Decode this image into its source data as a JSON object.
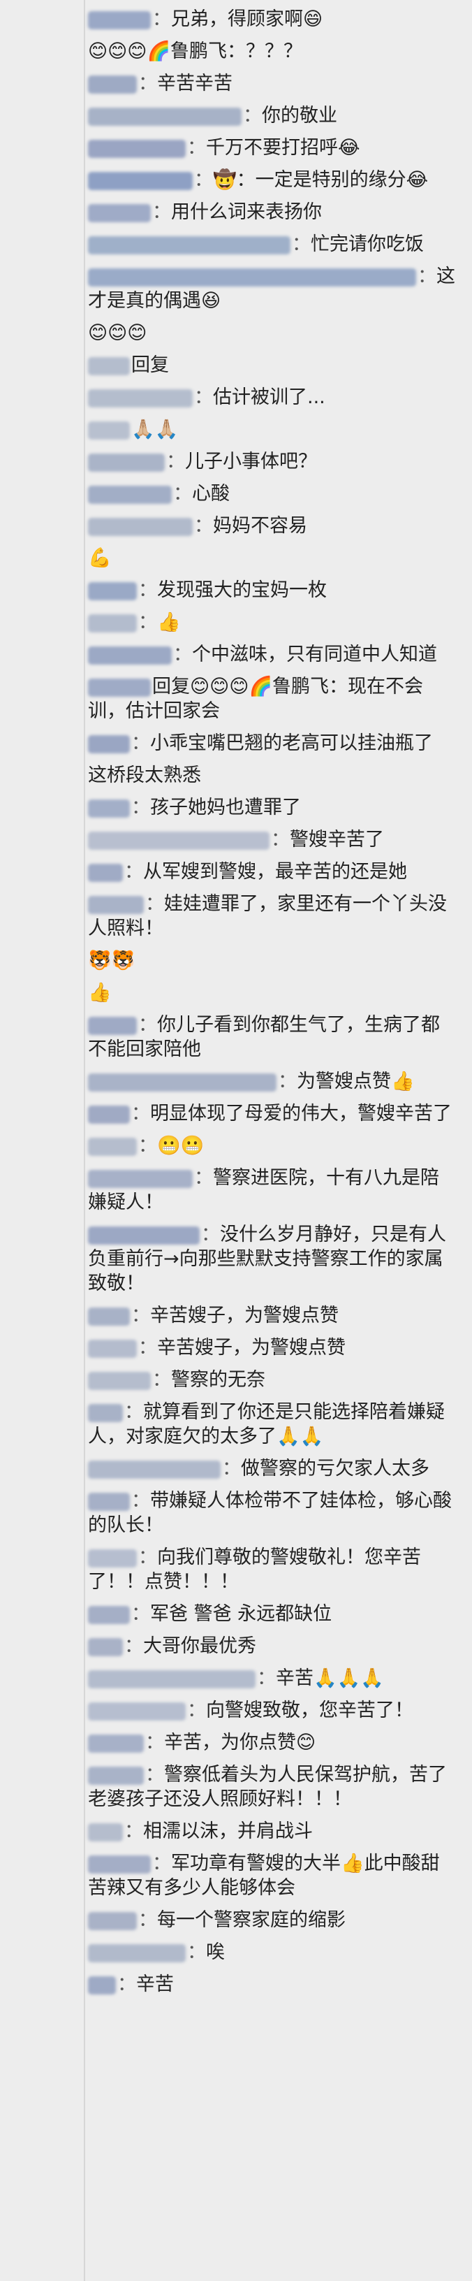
{
  "colors": {
    "background": "#ededed",
    "text": "#222222",
    "nick_link_blue": "#5c7fb8",
    "nick_blur_gray": "#b8b8b8"
  },
  "comments": [
    {
      "nick_w": 90,
      "nick_color": "#9aa8c6",
      "sep": "：",
      "text": "兄弟，得顾家啊😄"
    },
    {
      "nick_w": 0,
      "nick_color": "",
      "sep": "",
      "text": "😊😊😊🌈鲁鹏飞：？？？"
    },
    {
      "nick_w": 70,
      "nick_color": "#9eaac4",
      "sep": "：",
      "text": "辛苦辛苦"
    },
    {
      "nick_w": 220,
      "nick_color": "#a7b2c7",
      "sep": "：",
      "text": "你的敬业"
    },
    {
      "nick_w": 140,
      "nick_color": "#9aa5c3",
      "sep": "：",
      "text": "千万不要打招呼😂"
    },
    {
      "nick_w": 150,
      "nick_color": "#8ea0c4",
      "sep": "：",
      "text": "🤠：一定是特别的缘分😂"
    },
    {
      "nick_w": 90,
      "nick_color": "#9fabc7",
      "sep": "：",
      "text": "用什么词来表扬你"
    },
    {
      "nick_w": 290,
      "nick_color": "#9fb0c9",
      "sep": "：",
      "text": "忙完请你吃饭"
    },
    {
      "nick_w": 470,
      "nick_color": "#9aabc8",
      "sep": "：",
      "text": "这才是真的偶遇😆"
    },
    {
      "nick_w": 0,
      "nick_color": "",
      "sep": "",
      "text": "😊😊😊"
    },
    {
      "nick_w": 60,
      "nick_color": "#b4bdcd",
      "sep": "",
      "text": "回复"
    },
    {
      "nick_w": 150,
      "nick_color": "#b4bdcd",
      "sep": "：",
      "text": "估计被训了..."
    },
    {
      "nick_w": 60,
      "nick_color": "#b8c0cf",
      "sep": "",
      "text": "🙏🏼🙏🏼"
    },
    {
      "nick_w": 110,
      "nick_color": "#aab4c8",
      "sep": "：",
      "text": "儿子小事体吧？"
    },
    {
      "nick_w": 120,
      "nick_color": "#a2aec6",
      "sep": "：",
      "text": "心酸"
    },
    {
      "nick_w": 150,
      "nick_color": "#b1bacb",
      "sep": "：",
      "text": "妈妈不容易"
    },
    {
      "nick_w": 0,
      "nick_color": "",
      "sep": "",
      "text": "💪"
    },
    {
      "nick_w": 70,
      "nick_color": "#9aa9c6",
      "sep": "：",
      "text": "发现强大的宝妈一枚"
    },
    {
      "nick_w": 70,
      "nick_color": "#b3bccd",
      "sep": "：",
      "text": "👍"
    },
    {
      "nick_w": 120,
      "nick_color": "#9ca9c5",
      "sep": "：",
      "text": "个中滋味，只有同道中人知道"
    },
    {
      "nick_w": 90,
      "nick_color": "#9fabc6",
      "sep": "",
      "text": "回复😊😊😊🌈鲁鹏飞：现在不会训，估计回家会"
    },
    {
      "nick_w": 60,
      "nick_color": "#9aa6c3",
      "sep": "：",
      "text": "小乖宝嘴巴翘的老高可以挂油瓶了"
    },
    {
      "nick_w": 0,
      "nick_color": "",
      "sep": "",
      "text": ""
    },
    {
      "nick_w": 0,
      "nick_color": "",
      "sep": "",
      "text": "这桥段太熟悉"
    },
    {
      "nick_w": 60,
      "nick_color": "#a3afc8",
      "sep": "：",
      "text": "孩子她妈也遭罪了"
    },
    {
      "nick_w": 260,
      "nick_color": "#b8bfcf",
      "sep": "：",
      "text": "警嫂辛苦了"
    },
    {
      "nick_w": 50,
      "nick_color": "#a0abc5",
      "sep": "：",
      "text": "从军嫂到警嫂，最辛苦的还是她"
    },
    {
      "nick_w": 80,
      "nick_color": "#a9b3c8",
      "sep": "：",
      "text": "娃娃遭罪了，家里还有一个丫头没人照料！"
    },
    {
      "nick_w": 0,
      "nick_color": "",
      "sep": "",
      "text": "🐯🐯"
    },
    {
      "nick_w": 0,
      "nick_color": "",
      "sep": "",
      "text": "👍"
    },
    {
      "nick_w": 70,
      "nick_color": "#9faac5",
      "sep": "：",
      "text": "你儿子看到你都生气了，生病了都不能回家陪他"
    },
    {
      "nick_w": 270,
      "nick_color": "#a9b3c8",
      "sep": "：",
      "text": "为警嫂点赞👍"
    },
    {
      "nick_w": 60,
      "nick_color": "#a0aac4",
      "sep": "：",
      "text": "明显体现了母爱的伟大，警嫂辛苦了"
    },
    {
      "nick_w": 70,
      "nick_color": "#b5bdcd",
      "sep": "：",
      "text": "😬😬"
    },
    {
      "nick_w": 150,
      "nick_color": "#a7b1c8",
      "sep": "：",
      "text": "警察进医院，十有八九是陪嫌疑人！"
    },
    {
      "nick_w": 160,
      "nick_color": "#9ca8c4",
      "sep": "：",
      "text": "没什么岁月静好，只是有人负重前行→向那些默默支持警察工作的家属致敬！"
    },
    {
      "nick_w": 60,
      "nick_color": "#a8b2c7",
      "sep": "：",
      "text": "辛苦嫂子，为警嫂点赞"
    },
    {
      "nick_w": 70,
      "nick_color": "#b4bccd",
      "sep": "：",
      "text": "辛苦嫂子，为警嫂点赞"
    },
    {
      "nick_w": 90,
      "nick_color": "#b5bdcd",
      "sep": "：",
      "text": "警察的无奈"
    },
    {
      "nick_w": 50,
      "nick_color": "#a8b2c7",
      "sep": "：",
      "text": "就算看到了你还是只能选择陪着嫌疑人，对家庭欠的太多了🙏🙏"
    },
    {
      "nick_w": 190,
      "nick_color": "#b0b9cb",
      "sep": "：",
      "text": "做警察的亏欠家人太多"
    },
    {
      "nick_w": 60,
      "nick_color": "#a6b0c7",
      "sep": "：",
      "text": "带嫌疑人体检带不了娃体检，够心酸的队长！"
    },
    {
      "nick_w": 70,
      "nick_color": "#b6becf",
      "sep": "：",
      "text": "向我们尊敬的警嫂敬礼！您辛苦了！！点赞！！！"
    },
    {
      "nick_w": 60,
      "nick_color": "#a5afc6",
      "sep": "：",
      "text": "军爸 警爸 永远都缺位"
    },
    {
      "nick_w": 50,
      "nick_color": "#a9b2c7",
      "sep": "：",
      "text": "大哥你最优秀"
    },
    {
      "nick_w": 240,
      "nick_color": "#b3bccd",
      "sep": "：",
      "text": "辛苦🙏🙏🙏"
    },
    {
      "nick_w": 140,
      "nick_color": "#b6becf",
      "sep": "：",
      "text": "向警嫂致敬，您辛苦了！"
    },
    {
      "nick_w": 80,
      "nick_color": "#a7b1c8",
      "sep": "：",
      "text": "辛苦，为你点赞😊"
    },
    {
      "nick_w": 80,
      "nick_color": "#a9b3c8",
      "sep": "：",
      "text": "警察低着头为人民保驾护航，苦了老婆孩子还没人照顾好料！！！"
    },
    {
      "nick_w": 50,
      "nick_color": "#b5bdcd",
      "sep": "：",
      "text": "相濡以沫，并肩战斗"
    },
    {
      "nick_w": 90,
      "nick_color": "#a4aec6",
      "sep": "：",
      "text": "军功章有警嫂的大半👍此中酸甜苦辣又有多少人能够体会"
    },
    {
      "nick_w": 70,
      "nick_color": "#a9b2c7",
      "sep": "：",
      "text": "每一个警察家庭的缩影"
    },
    {
      "nick_w": 140,
      "nick_color": "#b1bacb",
      "sep": "：",
      "text": "唉"
    },
    {
      "nick_w": 40,
      "nick_color": "#9eaac5",
      "sep": "：",
      "text": "辛苦"
    }
  ]
}
